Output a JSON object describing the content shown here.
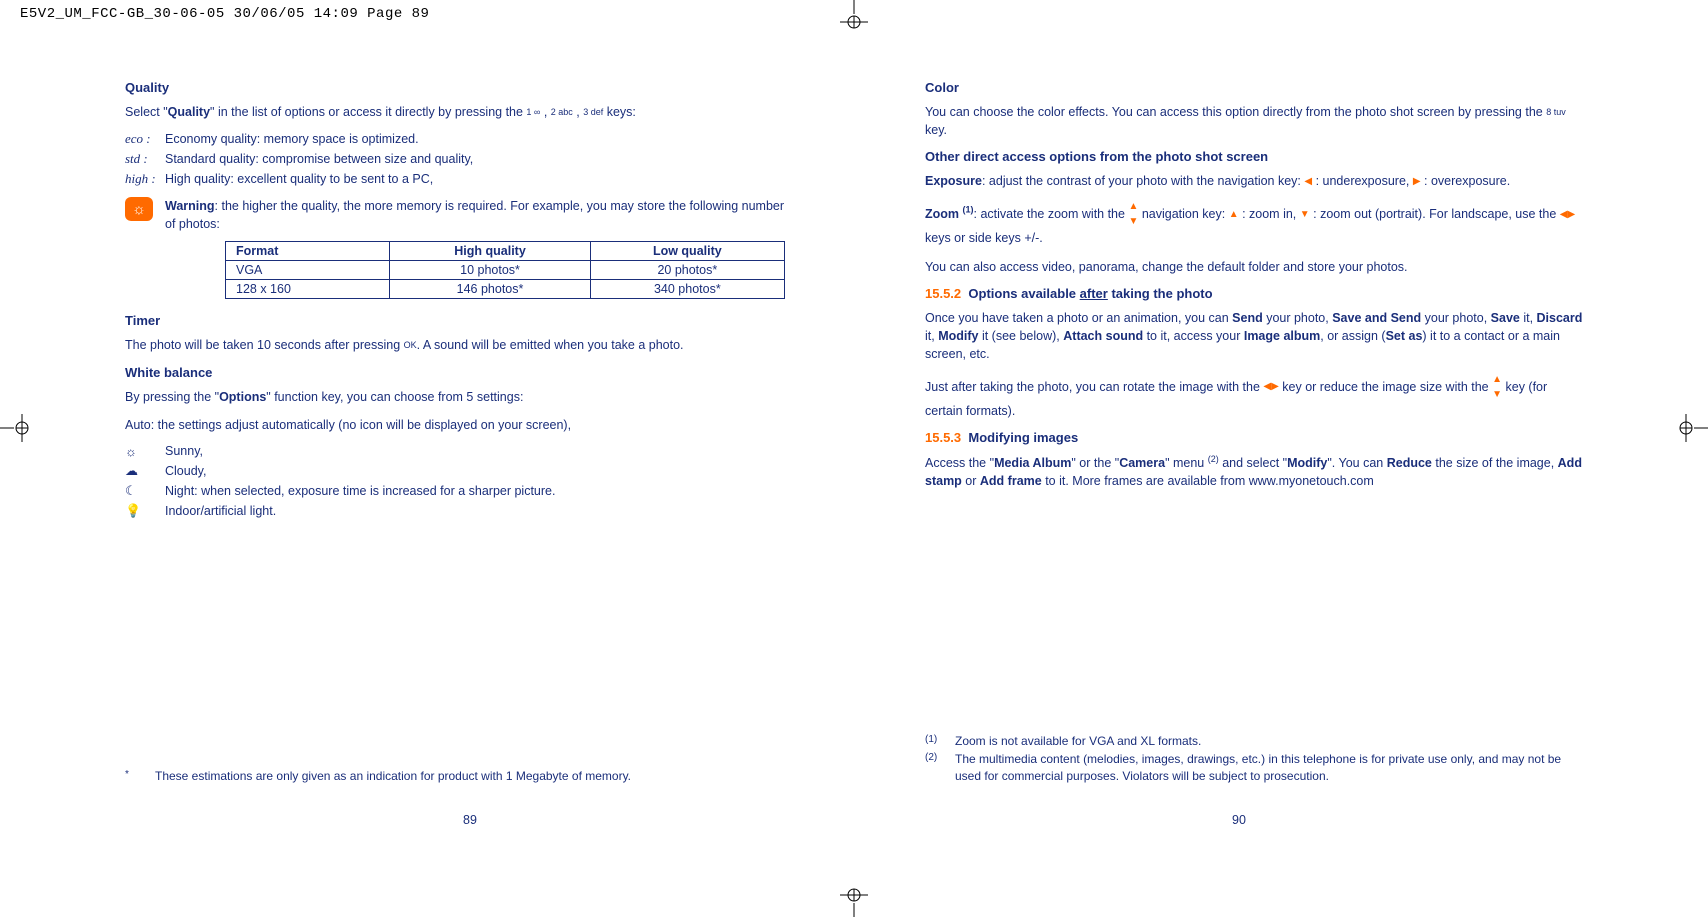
{
  "header_strip": "E5V2_UM_FCC-GB_30-06-05  30/06/05  14:09  Page 89",
  "left": {
    "h_quality": "Quality",
    "quality_intro_a": "Select \"",
    "quality_intro_b": "Quality",
    "quality_intro_c": "\" in the list of options or access it directly by pressing the ",
    "key1": "1 ∞",
    "key2": "2 abc",
    "key3": "3 def",
    "quality_intro_d": " keys:",
    "q_eco_icon": "eco :",
    "q_eco": "Economy quality: memory space is optimized.",
    "q_std_icon": "std :",
    "q_std": "Standard quality: compromise between size and quality,",
    "q_high_icon": "high :",
    "q_high": "High quality: excellent quality to be sent to a PC,",
    "warn_b": "Warning",
    "warn_t": ": the higher the quality, the more memory is required. For example, you may store the following number of photos:",
    "table": {
      "h_format": "Format",
      "h_hq": "High quality",
      "h_lq": "Low quality",
      "r1_f": "VGA",
      "r1_h": "10 photos*",
      "r1_l": "20 photos*",
      "r2_f": "128 x 160",
      "r2_h": "146 photos*",
      "r2_l": "340 photos*"
    },
    "h_timer": "Timer",
    "timer_a": "The photo will be taken 10 seconds after pressing ",
    "timer_key": "OK",
    "timer_b": ". A sound will be emitted when you take a photo.",
    "h_wb": "White balance",
    "wb_intro_a": "By pressing the \"",
    "wb_intro_b": "Options",
    "wb_intro_c": "\" function key, you can choose from 5 settings:",
    "wb_auto": "Auto: the settings adjust automatically (no icon will be displayed on your screen),",
    "wb_sunny": "Sunny,",
    "wb_cloudy": "Cloudy,",
    "wb_night": "Night: when selected, exposure time is increased for a sharper picture.",
    "wb_indoor": "Indoor/artificial light.",
    "fn_mark": "*",
    "fn_text": "These estimations are only given as an indication for product with 1 Megabyte of memory.",
    "page_num": "89"
  },
  "right": {
    "h_color": "Color",
    "color_a": "You can choose the color effects. You can access this option directly from the photo shot screen by pressing the ",
    "color_key": "8 tuv",
    "color_b": " key.",
    "h_other": "Other direct access options from the photo shot screen",
    "exp_b": "Exposure",
    "exp_t1": ": adjust the contrast of your photo with the navigation key: ",
    "exp_t2": " : underexposure, ",
    "exp_t3": " : overexposure.",
    "zoom_b": "Zoom ",
    "zoom_sup": "(1)",
    "zoom_t1": ": activate the zoom with the ",
    "zoom_t2": " navigation key: ",
    "zoom_t3": " : zoom in, ",
    "zoom_t4": " : zoom out (portrait). For landscape, use the ",
    "zoom_t5": " keys or side keys +/-.",
    "also": "You can also access video, panorama, change the default folder and store your photos.",
    "sec1_num": "15.5.2",
    "sec1_a": "Options available ",
    "sec1_u": "after",
    "sec1_b": " taking the photo",
    "after_a": "Once you have taken a photo or an animation, you can ",
    "after_send": "Send",
    "after_b": " your photo, ",
    "after_sas": "Save and Send",
    "after_c": " your photo, ",
    "after_save": "Save",
    "after_d": " it, ",
    "after_discard": "Discard",
    "after_e": " it, ",
    "after_modify": "Modify",
    "after_f": " it (see below), ",
    "after_attach": "Attach sound",
    "after_g": " to it, access your ",
    "after_album": "Image album",
    "after_h": ", or assign (",
    "after_setas": "Set as",
    "after_i": ") it to a contact or a main screen, etc.",
    "rotate_a": "Just after taking the photo, you can rotate the image with the ",
    "rotate_b": " key or reduce the image size with the ",
    "rotate_c": " key (for certain formats).",
    "sec2_num": "15.5.3",
    "sec2_t": "Modifying images",
    "mod_a": "Access the \"",
    "mod_ma": "Media Album",
    "mod_b": "\" or the \"",
    "mod_cam": "Camera",
    "mod_c": "\" menu ",
    "mod_sup": "(2)",
    "mod_d": " and select \"",
    "mod_modify": "Modify",
    "mod_e": "\". You can ",
    "mod_reduce": "Reduce",
    "mod_f": " the size of the image, ",
    "mod_stamp": "Add stamp",
    "mod_g": " or ",
    "mod_frame": "Add frame",
    "mod_h": " to it. More frames are available from www.myonetouch.com",
    "fn1_m": "(1)",
    "fn1_t": "Zoom is not available for VGA and XL formats.",
    "fn2_m": "(2)",
    "fn2_t": "The multimedia content (melodies, images, drawings, etc.) in this telephone is for private use only, and may not be used for commercial purposes. Violators will be subject to prosecution.",
    "page_num": "90"
  },
  "chart_data": {
    "type": "table",
    "title": "Photo storage by quality",
    "columns": [
      "Format",
      "High quality",
      "Low quality"
    ],
    "rows": [
      [
        "VGA",
        "10 photos*",
        "20 photos*"
      ],
      [
        "128 x 160",
        "146 photos*",
        "340 photos*"
      ]
    ]
  }
}
